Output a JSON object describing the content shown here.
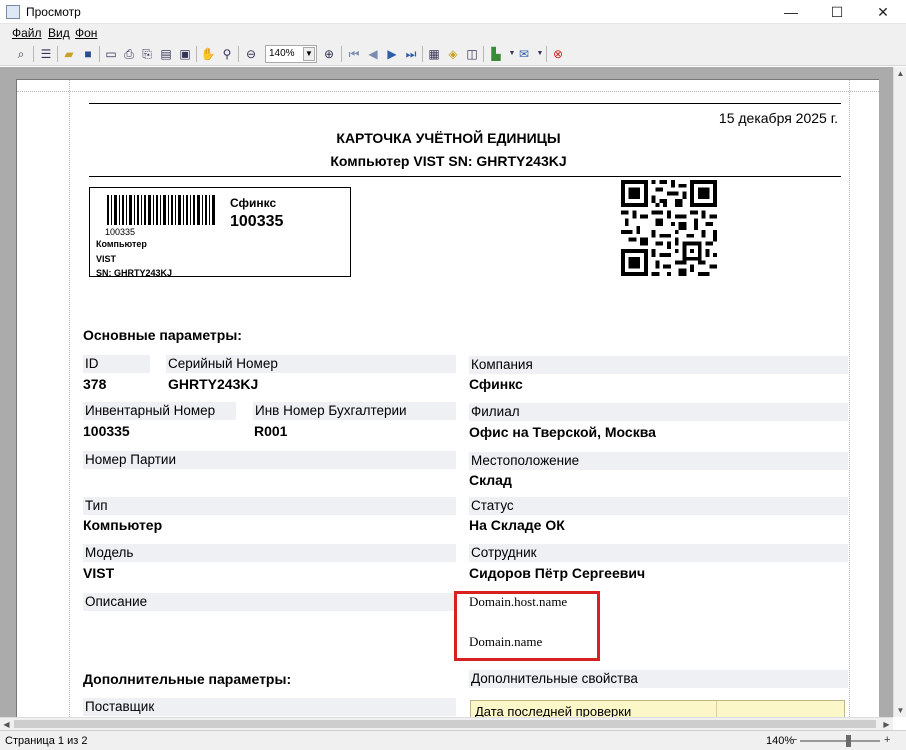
{
  "window": {
    "title": "Просмотр",
    "minimize": "—",
    "maximize": "☐",
    "close": "✕"
  },
  "menu": [
    "Файл",
    "Вид",
    "Фон"
  ],
  "toolbar": {
    "zoom_value": "140%"
  },
  "status": {
    "page": "Страница 1 из 2",
    "zoom": "140%",
    "minus": "−",
    "plus": "+"
  },
  "doc": {
    "date": "15 декабря 2025 г.",
    "title": "КАРТОЧКА УЧЁТНОЙ ЕДИНИЦЫ",
    "subtitle": "Компьютер VIST SN: GHRTY243KJ",
    "label": {
      "barcode_number": "100335",
      "company": "Сфинкс",
      "inventory": "100335",
      "line1": "Компьютер",
      "line2": "VIST",
      "line3": "SN:  GHRTY243KJ"
    },
    "main_section": "Основные параметры:",
    "fields": {
      "id_label": "ID",
      "id_value": "378",
      "serial_label": "Серийный Номер",
      "serial_value": "GHRTY243KJ",
      "inv_label": "Инвентарный Номер",
      "inv_value": "100335",
      "acc_label": "Инв Номер Бухгалтерии",
      "acc_value": "R001",
      "batch_label": "Номер Партии",
      "type_label": "Тип",
      "type_value": "Компьютер",
      "model_label": "Модель",
      "model_value": "VIST",
      "desc_label": "Описание",
      "company_label": "Компания",
      "company_value": "Сфинкс",
      "branch_label": "Филиал",
      "branch_value": "Офис на Тверской, Москва",
      "location_label": "Местоположение",
      "location_value": "Склад",
      "status_label": "Статус",
      "status_value": "На Складе ОК",
      "employee_label": "Сотрудник",
      "employee_value": "Сидоров Пётр Сергеевич",
      "host_value": "Domain.host.name",
      "domain_value": "Domain.name"
    },
    "extra_section": "Дополнительные параметры:",
    "supplier_label": "Поставщик",
    "extra_props_label": "Дополнительные свойства",
    "last_check_label": "Дата последней проверки"
  },
  "colors": {
    "highlight": "#d72020",
    "field_bg": "#eef0f4",
    "table_head": "#fbf7c8"
  }
}
